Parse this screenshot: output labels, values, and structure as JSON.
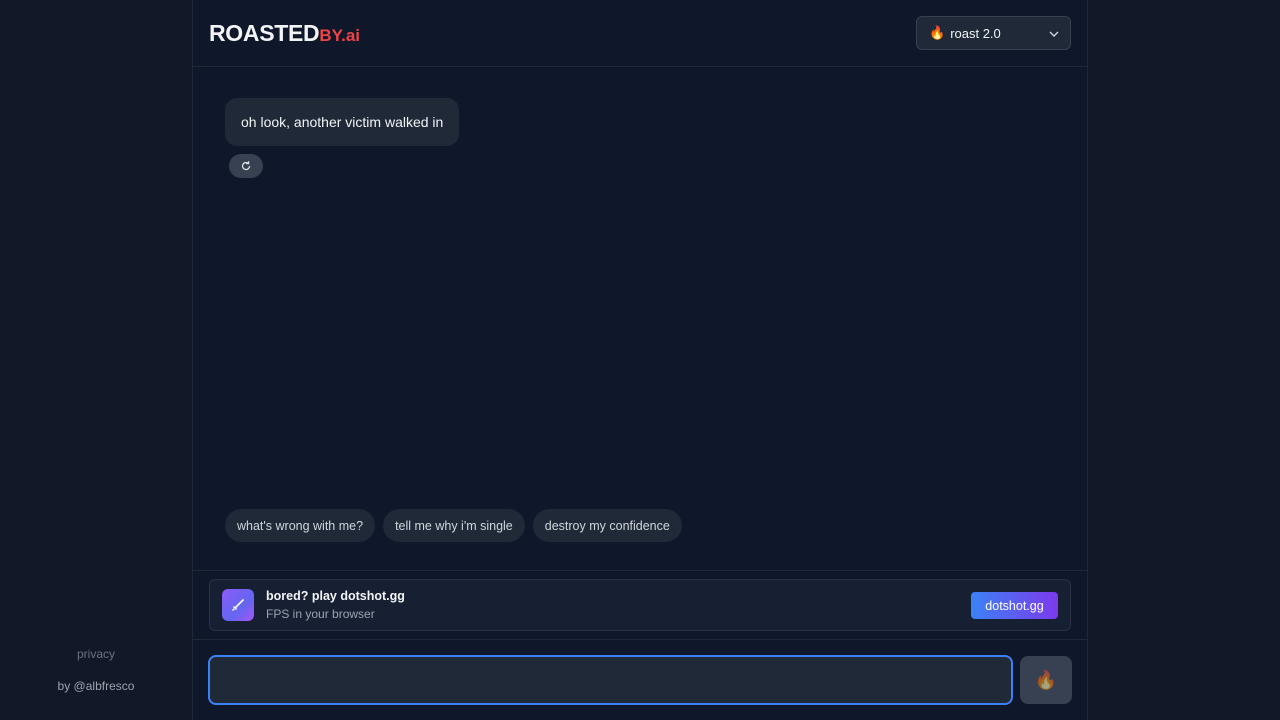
{
  "sidebar": {
    "privacy_label": "privacy",
    "credit": "by @albfresco"
  },
  "header": {
    "logo_main": "ROASTED",
    "logo_suffix": "BY.ai",
    "model_select": {
      "icon": "flame-icon",
      "value": "roast 2.0"
    }
  },
  "chat": {
    "messages": [
      {
        "role": "assistant",
        "text": "oh look, another victim walked in"
      }
    ],
    "regenerate_icon": "refresh-icon"
  },
  "suggestions": [
    "what's wrong with me?",
    "tell me why i'm single",
    "destroy my confidence"
  ],
  "ad": {
    "icon": "sword-icon",
    "title": "bored? play dotshot.gg",
    "subtitle": "FPS in your browser",
    "cta": "dotshot.gg"
  },
  "composer": {
    "value": "",
    "placeholder": "",
    "send_icon": "flame-icon"
  },
  "colors": {
    "background": "#111827",
    "panel": "#0f172a",
    "accent": "#3b82f6",
    "brand_red": "#ef4444"
  }
}
